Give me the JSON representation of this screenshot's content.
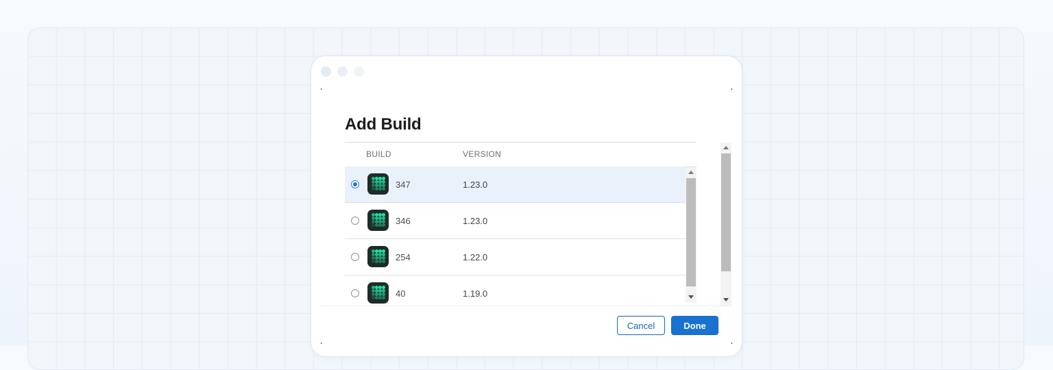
{
  "dialog": {
    "title": "Add Build",
    "columns": {
      "build": "BUILD",
      "version": "VERSION"
    },
    "builds": [
      {
        "build": "347",
        "version": "1.23.0",
        "selected": true
      },
      {
        "build": "346",
        "version": "1.23.0",
        "selected": false
      },
      {
        "build": "254",
        "version": "1.22.0",
        "selected": false
      },
      {
        "build": "40",
        "version": "1.19.0",
        "selected": false
      }
    ],
    "buttons": {
      "cancel": "Cancel",
      "done": "Done"
    }
  },
  "colors": {
    "accent": "#1a72d0",
    "selected_row": "#e9f1fa",
    "app_icon_bg": "#1f2b27",
    "app_icon_dots": "#1fe0a4"
  },
  "icons": {
    "app": "app-grid-icon",
    "scroll_up": "triangle-up-icon",
    "scroll_down": "triangle-down-icon"
  }
}
